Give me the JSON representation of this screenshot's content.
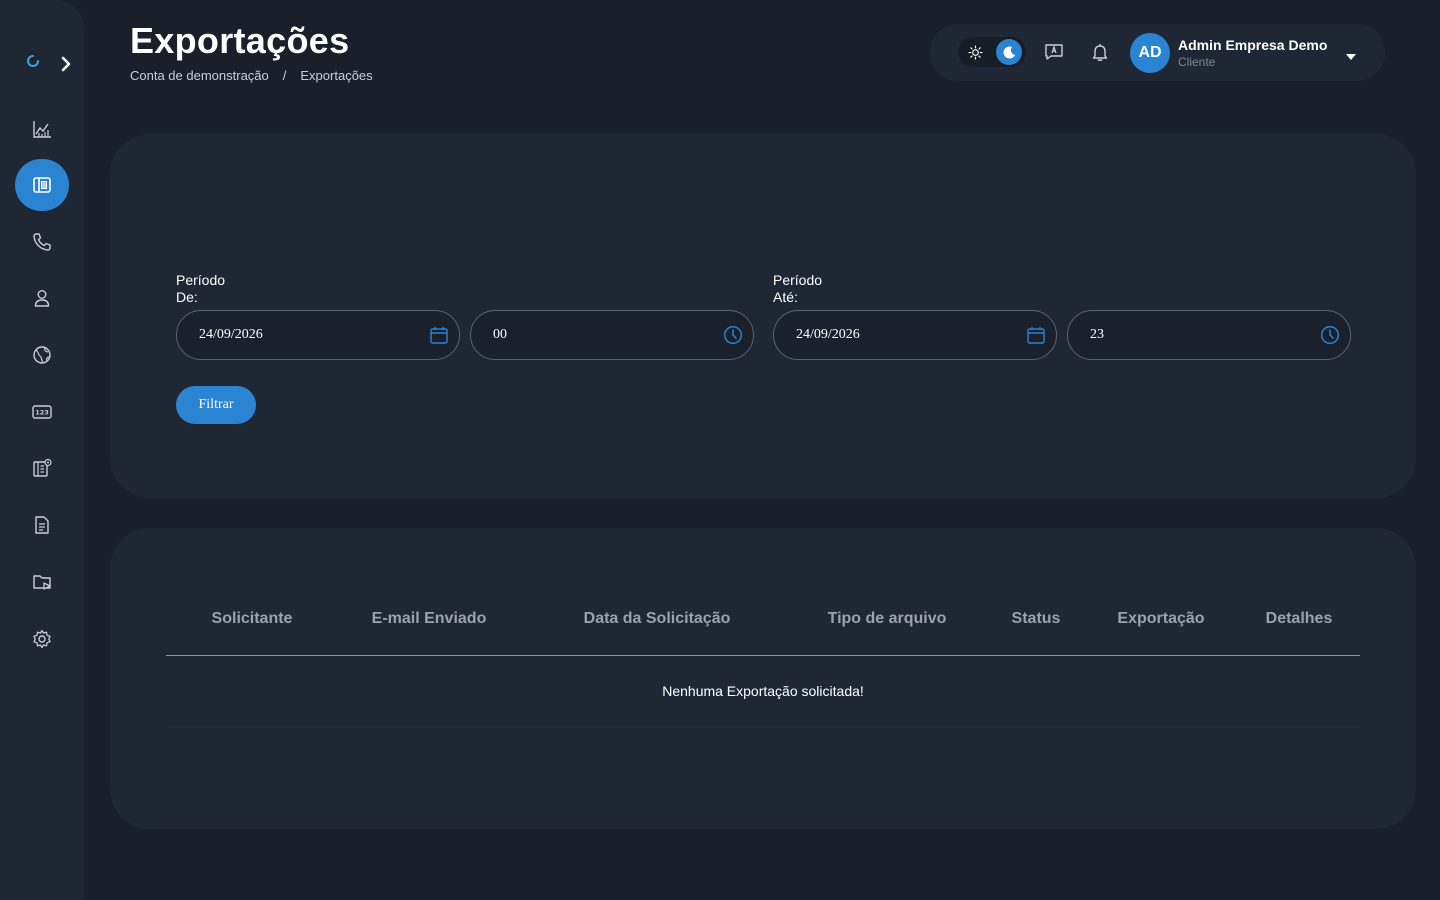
{
  "page": {
    "title": "Exportações",
    "breadcrumb": [
      "Conta de demonstração",
      "/",
      "Exportações"
    ]
  },
  "sidebar": {
    "items": [
      {
        "name": "chart-icon",
        "active": false
      },
      {
        "name": "export-icon",
        "active": true
      },
      {
        "name": "phone-icon",
        "active": false
      },
      {
        "name": "user-icon",
        "active": false
      },
      {
        "name": "globe-icon",
        "active": false
      },
      {
        "name": "numbers-icon",
        "active": false
      },
      {
        "name": "records-icon",
        "active": false
      },
      {
        "name": "document-icon",
        "active": false
      },
      {
        "name": "folder-play-icon",
        "active": false
      },
      {
        "name": "settings-icon",
        "active": false
      }
    ]
  },
  "topbar": {
    "avatar_initials": "AD",
    "user_name": "Admin Empresa Demo",
    "user_role": "Cliente",
    "theme": "dark"
  },
  "filter": {
    "from_label_line1": "Período",
    "from_label_line2": "De:",
    "to_label_line1": "Período",
    "to_label_line2": "Até:",
    "from_date": "24/09/2026",
    "from_hour": "00",
    "to_date": "24/09/2026",
    "to_hour": "23",
    "button_label": "Filtrar"
  },
  "table": {
    "columns": [
      "Solicitante",
      "E-mail Enviado",
      "Data da Solicitação",
      "Tipo de arquivo",
      "Status",
      "Exportação",
      "Detalhes"
    ],
    "rows": [],
    "empty_message": "Nenhuma Exportação solicitada!"
  },
  "colors": {
    "background": "#1a1f29",
    "panel": "#202734",
    "accent": "#2a84d2",
    "muted_text": "#9aa2ad"
  }
}
